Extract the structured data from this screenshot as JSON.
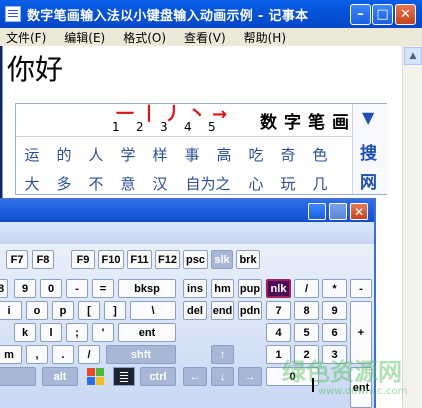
{
  "notepad": {
    "title": "数字笔画输入法以小键盘输入动画示例 - 记事本",
    "min_glyph": "–",
    "max_glyph": "□",
    "close_glyph": "✕",
    "menu": [
      "文件(F)",
      "编辑(E)",
      "格式(O)",
      "查看(V)",
      "帮助(H)"
    ],
    "content": "你好",
    "scroll_up_glyph": "▲"
  },
  "ime": {
    "strokes": [
      {
        "glyph": "一",
        "num": "1"
      },
      {
        "glyph": "丨",
        "num": "2"
      },
      {
        "glyph": "丿",
        "num": "3"
      },
      {
        "glyph": "丶",
        "num": "4"
      },
      {
        "glyph": "→",
        "num": "5"
      }
    ],
    "radicals": [
      "数",
      "字",
      "笔",
      "画"
    ],
    "row1": [
      "运",
      "的",
      "人",
      "学",
      "样",
      "事",
      "高",
      "吃",
      "奇",
      "色"
    ],
    "row2": [
      "大",
      "多",
      "不",
      "意",
      "汉",
      "自为之",
      "心",
      "玩",
      "几"
    ],
    "down_arrow": "▼",
    "search_label": "搜",
    "web_label": "网"
  },
  "osk": {
    "close_glyph": "✕",
    "row_fn": [
      "F7",
      "F8",
      "F9",
      "F10",
      "F11",
      "F12",
      "psc",
      "slk",
      "brk"
    ],
    "row1": [
      "8",
      "9",
      "0",
      "-",
      "=",
      "bksp",
      "ins",
      "hm",
      "pup",
      "nlk",
      "/",
      "*",
      "-"
    ],
    "row2": [
      "i",
      "o",
      "p",
      "[",
      "]",
      "\\",
      "del",
      "end",
      "pdn",
      "7",
      "8",
      "9"
    ],
    "row3": [
      "k",
      "l",
      ";",
      "'",
      "ent",
      "4",
      "5",
      "6",
      "+"
    ],
    "row4": [
      "m",
      ",",
      ".",
      "/",
      "shft",
      "↑",
      "1",
      "2",
      "3"
    ],
    "row5": [
      "alt",
      "ctrl",
      "←",
      "↓",
      "→",
      "0",
      "ent"
    ]
  },
  "watermark": {
    "text": "绿色资源网",
    "url": "www.downcc.com"
  }
}
